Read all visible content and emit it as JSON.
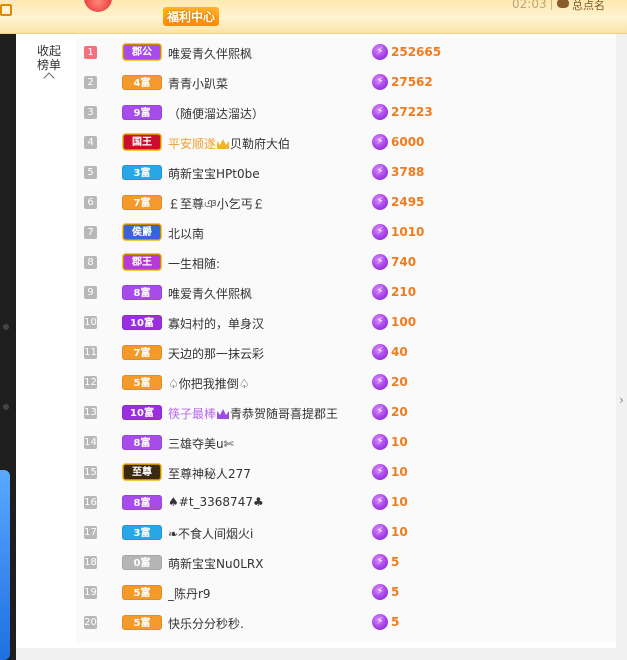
{
  "topbar": {
    "welfare_label": "福利中心",
    "hud_number": "02:03",
    "hud_text": "总点名",
    "icons": [
      "corner-icon",
      "gift-emblem-icon",
      "hud-bag-icon"
    ]
  },
  "panel": {
    "collapse_label_1": "收起",
    "collapse_label_2": "榜单",
    "help_icon": "?"
  },
  "colors": {
    "score": "#f07c1e",
    "rank_top1": "#f66f7f",
    "rank_default": "#b8b8b8",
    "coin": "#a743e8"
  },
  "rows": [
    {
      "rank": "1",
      "badge": "郡公",
      "badge_color": "#a74bea",
      "royal": true,
      "name": "唯爱青久伴熙枫",
      "score": "252665"
    },
    {
      "rank": "2",
      "badge": "4富",
      "badge_color": "#f39a2a",
      "royal": false,
      "name": "青青小趴菜",
      "score": "27562"
    },
    {
      "rank": "3",
      "badge": "9富",
      "badge_color": "#a74bea",
      "royal": false,
      "name": "（随便溜达溜达）",
      "score": "27223"
    },
    {
      "rank": "4",
      "badge": "国王",
      "badge_color": "#c8102e",
      "royal": true,
      "name_hl": "平安顺遂",
      "name_rest": "贝勒府大伯",
      "crown": "gold",
      "score": "6000"
    },
    {
      "rank": "5",
      "badge": "3富",
      "badge_color": "#27a7e6",
      "royal": false,
      "name": "萌新宝宝HPt0be",
      "score": "3788"
    },
    {
      "rank": "6",
      "badge": "7富",
      "badge_color": "#f39a2a",
      "royal": false,
      "name": "￡至尊ঞ小乞丐￡",
      "score": "2495"
    },
    {
      "rank": "7",
      "badge": "侯爵",
      "badge_color": "#3b63d9",
      "royal": true,
      "name": "北以南",
      "score": "1010"
    },
    {
      "rank": "8",
      "badge": "郡王",
      "badge_color": "#b63ad6",
      "royal": true,
      "name": "一生相随:",
      "score": "740"
    },
    {
      "rank": "9",
      "badge": "8富",
      "badge_color": "#a74bea",
      "royal": false,
      "name": "唯爱青久伴熙枫",
      "score": "210"
    },
    {
      "rank": "10",
      "badge": "10富",
      "badge_color": "#9b2fe0",
      "royal": false,
      "name": "寡妇村的，单身汉",
      "score": "100"
    },
    {
      "rank": "11",
      "badge": "7富",
      "badge_color": "#f39a2a",
      "royal": false,
      "name": "天边的那一抹云彩",
      "score": "40"
    },
    {
      "rank": "12",
      "badge": "5富",
      "badge_color": "#f39a2a",
      "royal": false,
      "name": "♤你把我推倒♤",
      "score": "20"
    },
    {
      "rank": "13",
      "badge": "10富",
      "badge_color": "#9b2fe0",
      "royal": false,
      "name_hl2": "筷子最棒",
      "name_rest": "青恭贺随哥喜提郡王",
      "crown": "purple",
      "score": "20"
    },
    {
      "rank": "14",
      "badge": "8富",
      "badge_color": "#a74bea",
      "royal": false,
      "name": "三雄夺美u✄",
      "score": "10"
    },
    {
      "rank": "15",
      "badge": "至尊",
      "badge_color": "#3a2a12",
      "royal": true,
      "name": "至尊神秘人277",
      "score": "10"
    },
    {
      "rank": "16",
      "badge": "8富",
      "badge_color": "#a74bea",
      "royal": false,
      "name": "♠#t_3368747♣",
      "score": "10"
    },
    {
      "rank": "17",
      "badge": "3富",
      "badge_color": "#27a7e6",
      "royal": false,
      "name": "❧不食人间烟火i",
      "score": "10"
    },
    {
      "rank": "18",
      "badge": "0富",
      "badge_color": "#b5b5b5",
      "royal": false,
      "name": "萌新宝宝Nu0LRX",
      "score": "5"
    },
    {
      "rank": "19",
      "badge": "5富",
      "badge_color": "#f39a2a",
      "royal": false,
      "name": "_陈丹r9",
      "score": "5"
    },
    {
      "rank": "20",
      "badge": "5富",
      "badge_color": "#f39a2a",
      "royal": false,
      "name": "快乐分分秒秒.",
      "score": "5"
    }
  ]
}
